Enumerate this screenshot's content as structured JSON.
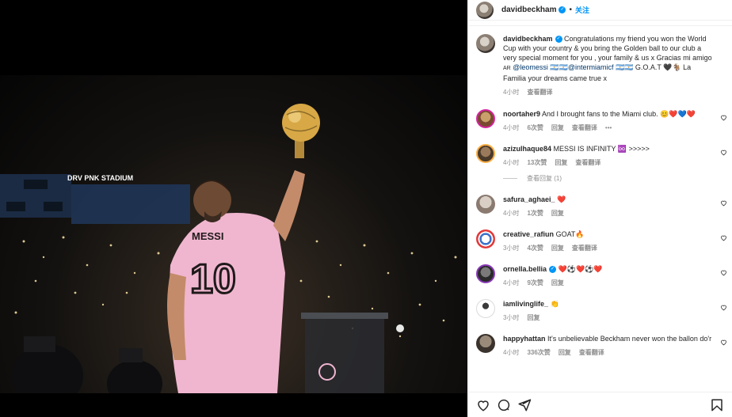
{
  "header": {
    "username": "davidbeckham",
    "follow_label": "关注"
  },
  "caption": {
    "username": "davidbeckham",
    "text_pre": "Congratulations my friend you won the World Cup with your country & you bring the Golden ball to our club a very special moment for you , your family & us x Gracias mi amigo ",
    "ar": "AR",
    "mention1": "@leomessi",
    "mid_flags": "🇦🇷🇦🇷",
    "mention2": "@intermiamicf",
    "post_flags": "🇦🇷🇦🇷 G.O.A.T 🖤🐐 La Familia your dreams came true x",
    "time": "4小时",
    "translate": "查看翻译"
  },
  "comments": [
    {
      "username": "noortaher9",
      "text": "And I brought fans to the Miami club.",
      "emoji": "😊❤️💙❤️",
      "time": "4小时",
      "likes": "6次赞",
      "reply": "回复",
      "translate": "查看翻译",
      "more": "•••",
      "avatar_color": "#c9a06a"
    },
    {
      "username": "azizulhaque84",
      "text": "MESSI IS INFINITY",
      "emoji": "♾️ >>>>>",
      "time": "4小时",
      "likes": "13次赞",
      "reply": "回复",
      "translate": "查看翻译",
      "view_replies": "查看回复 (1)",
      "avatar_color": "#7a5a3e"
    },
    {
      "username": "safura_aghaei_",
      "text": "",
      "emoji": "❤️",
      "time": "4小时",
      "likes": "1次赞",
      "reply": "回复",
      "avatar_color": "#b9b0a8"
    },
    {
      "username": "creative_rafiun",
      "text": "GOAT",
      "emoji": "🔥",
      "time": "3小时",
      "likes": "4次赞",
      "reply": "回复",
      "translate": "查看翻译",
      "avatar_color": "#3d74c9"
    },
    {
      "username": "ornella.bellia",
      "text": "",
      "emoji": "❤️⚽❤️⚽❤️",
      "time": "4小时",
      "likes": "9次赞",
      "reply": "回复",
      "avatar_color": "#4a4a4a"
    },
    {
      "username": "iamlivinglife_",
      "text": "",
      "emoji": "👏",
      "time": "3小时",
      "reply": "回复",
      "avatar_color": "#ffffff"
    },
    {
      "username": "happyhattan",
      "text": "It's unbelievable Beckham never won the ballon do'r",
      "emoji": "",
      "time": "4小时",
      "likes": "336次赞",
      "reply": "回复",
      "translate": "查看翻译",
      "avatar_color": "#5b5048"
    }
  ],
  "photo": {
    "stadium_sign": "DRV PNK STADIUM",
    "shirt_name": "MESSI",
    "shirt_number": "10"
  },
  "colors": {
    "accent": "#0095f6",
    "shirt_pink": "#f0b6cf"
  },
  "icons": [
    "heart-icon",
    "comment-icon",
    "share-icon",
    "bookmark-icon",
    "more-icon",
    "verified-icon"
  ]
}
